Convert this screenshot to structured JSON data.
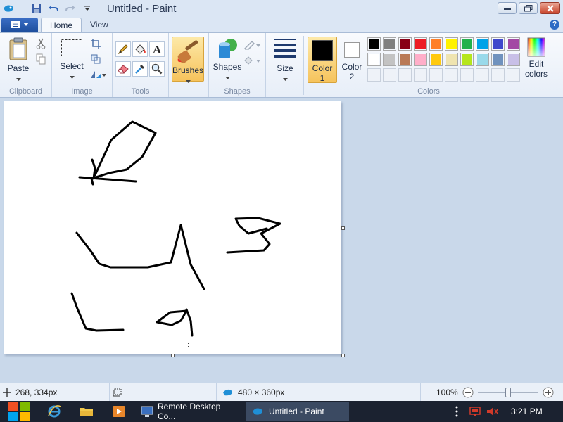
{
  "window": {
    "title": "Untitled - Paint"
  },
  "tabs": {
    "home": "Home",
    "view": "View",
    "help": "?"
  },
  "groups": {
    "clipboard": "Clipboard",
    "image": "Image",
    "tools": "Tools",
    "shapes": "Shapes",
    "colors": "Colors"
  },
  "buttons": {
    "paste": "Paste",
    "select": "Select",
    "brushes": "Brushes",
    "shapes": "Shapes",
    "size": "Size",
    "color1_a": "Color",
    "color1_b": "1",
    "color2_a": "Color",
    "color2_b": "2",
    "edit_a": "Edit",
    "edit_b": "colors"
  },
  "colors": {
    "color1": "#000000",
    "color2": "#ffffff",
    "accent": "#f6c35c",
    "palette_row1": [
      "#000000",
      "#7f7f7f",
      "#880015",
      "#ed1c24",
      "#ff7f27",
      "#fff200",
      "#22b14c",
      "#00a2e8",
      "#3f48cc",
      "#a349a4"
    ],
    "palette_row2": [
      "#ffffff",
      "#c3c3c3",
      "#b97a57",
      "#ffaec9",
      "#ffc90e",
      "#efe4b0",
      "#b5e61d",
      "#99d9ea",
      "#7092be",
      "#c8bfe7"
    ]
  },
  "status": {
    "cursor": "268, 334px",
    "image_size": "480 × 360px",
    "zoom": "100%",
    "zoom_fraction": 0.5
  },
  "taskbar": {
    "rdc": "Remote Desktop Co...",
    "paint": "Untitled - Paint",
    "time": "3:21 PM"
  }
}
